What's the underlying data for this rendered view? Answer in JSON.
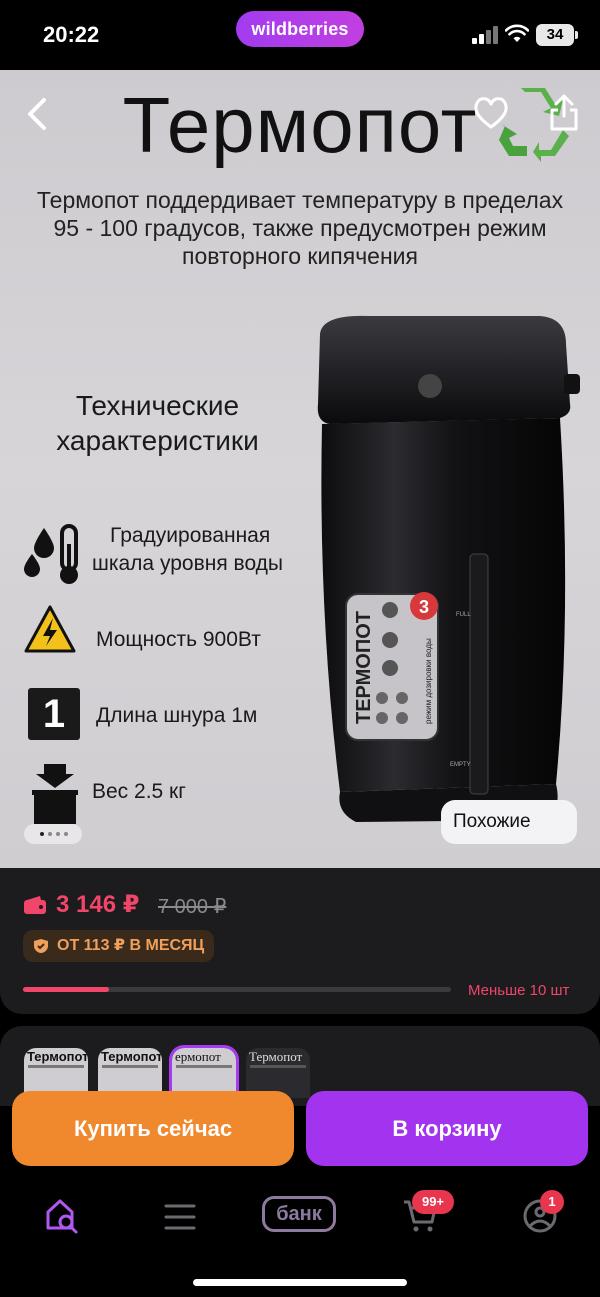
{
  "status_bar": {
    "time": "20:22",
    "brand": "wildberries",
    "battery": "34"
  },
  "hero": {
    "title": "Термопот",
    "description": "Термопот поддердивает температуру в пределах 95 - 100 градусов, также предусмотрен режим повторного кипячения",
    "specs_title": "Технические характеристики",
    "specs": [
      {
        "icon": "water-thermometer-icon",
        "text_line1": "Градуированная",
        "text_line2": "шкала уровня воды"
      },
      {
        "icon": "high-voltage-icon",
        "text": "Мощность 900Вт"
      },
      {
        "icon": "number-one-icon",
        "text": "Длина шнура 1м"
      },
      {
        "icon": "weight-icon",
        "text": "Вес 2.5 кг"
      }
    ],
    "kettle_panel": {
      "brand": "ТЕРМОПОТ",
      "number": "3",
      "side_text": "режим дозировки воды",
      "full": "FULL",
      "empty": "EMPTY"
    },
    "gallery_index": 0,
    "gallery_count": 4,
    "similar_button": "Похожие"
  },
  "price": {
    "current": "3 146 ₽",
    "old": "7 000 ₽",
    "installment": "ОТ 113 ₽ В МЕСЯЦ",
    "stock_label": "Меньше 10 шт",
    "stock_level_fraction": 0.2
  },
  "thumbnails": [
    {
      "label": "Термопот",
      "selected": false
    },
    {
      "label": "Термопот",
      "selected": false
    },
    {
      "label": "ермопот",
      "selected": true
    },
    {
      "label": "Термопот",
      "selected": false
    }
  ],
  "actions": {
    "buy_now": "Купить сейчас",
    "add_to_cart": "В корзину"
  },
  "nav": {
    "items": [
      "home-search-icon",
      "menu-icon",
      "bank-icon",
      "cart-icon",
      "profile-icon"
    ],
    "bank_label": "банк",
    "cart_badge": "99+",
    "profile_badge": "1"
  },
  "colors": {
    "accent": "#a234f0",
    "buy": "#f0882e",
    "price": "#f2456a",
    "panel": "#1c1b1e"
  }
}
